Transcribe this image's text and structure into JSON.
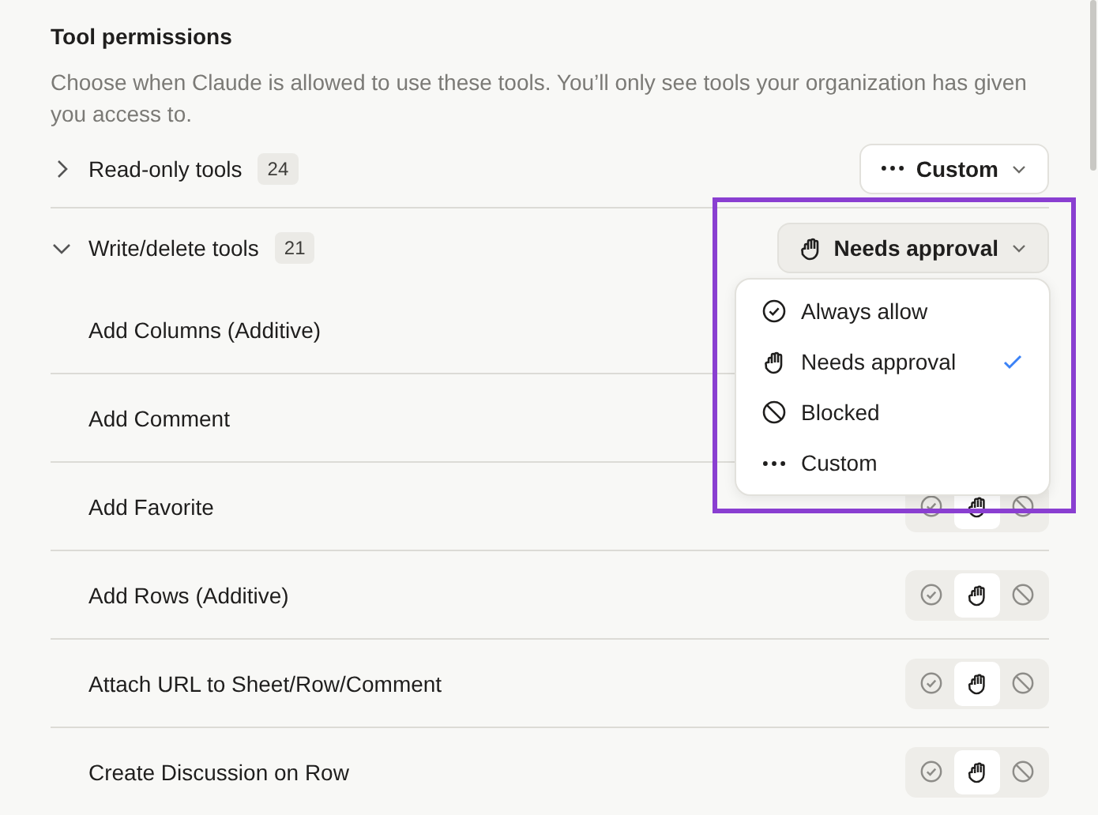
{
  "section": {
    "title": "Tool permissions",
    "description": "Choose when Claude is allowed to use these tools. You’ll only see tools your organization has given you access to."
  },
  "groups": [
    {
      "name": "Read-only tools",
      "count": "24",
      "expanded": false,
      "setting": {
        "kind": "custom",
        "label": "Custom"
      }
    },
    {
      "name": "Write/delete tools",
      "count": "21",
      "expanded": true,
      "setting": {
        "kind": "approval",
        "label": "Needs approval"
      },
      "tools": [
        {
          "name": "Add Columns (Additive)"
        },
        {
          "name": "Add Comment"
        },
        {
          "name": "Add Favorite",
          "choices": [
            {
              "kind": "allow",
              "selected": false
            },
            {
              "kind": "approval",
              "selected": true
            },
            {
              "kind": "blocked",
              "selected": false
            }
          ]
        },
        {
          "name": "Add Rows (Additive)",
          "choices": [
            {
              "kind": "allow",
              "selected": false
            },
            {
              "kind": "approval",
              "selected": true
            },
            {
              "kind": "blocked",
              "selected": false
            }
          ]
        },
        {
          "name": "Attach URL to Sheet/Row/Comment",
          "choices": [
            {
              "kind": "allow",
              "selected": false
            },
            {
              "kind": "approval",
              "selected": true
            },
            {
              "kind": "blocked",
              "selected": false
            }
          ]
        },
        {
          "name": "Create Discussion on Row",
          "choices": [
            {
              "kind": "allow",
              "selected": false
            },
            {
              "kind": "approval",
              "selected": true
            },
            {
              "kind": "blocked",
              "selected": false
            }
          ]
        }
      ]
    }
  ],
  "menu": {
    "items": [
      {
        "kind": "allow",
        "label": "Always allow",
        "selected": false
      },
      {
        "kind": "approval",
        "label": "Needs approval",
        "selected": true
      },
      {
        "kind": "blocked",
        "label": "Blocked",
        "selected": false
      },
      {
        "kind": "custom",
        "label": "Custom",
        "selected": false
      }
    ]
  }
}
